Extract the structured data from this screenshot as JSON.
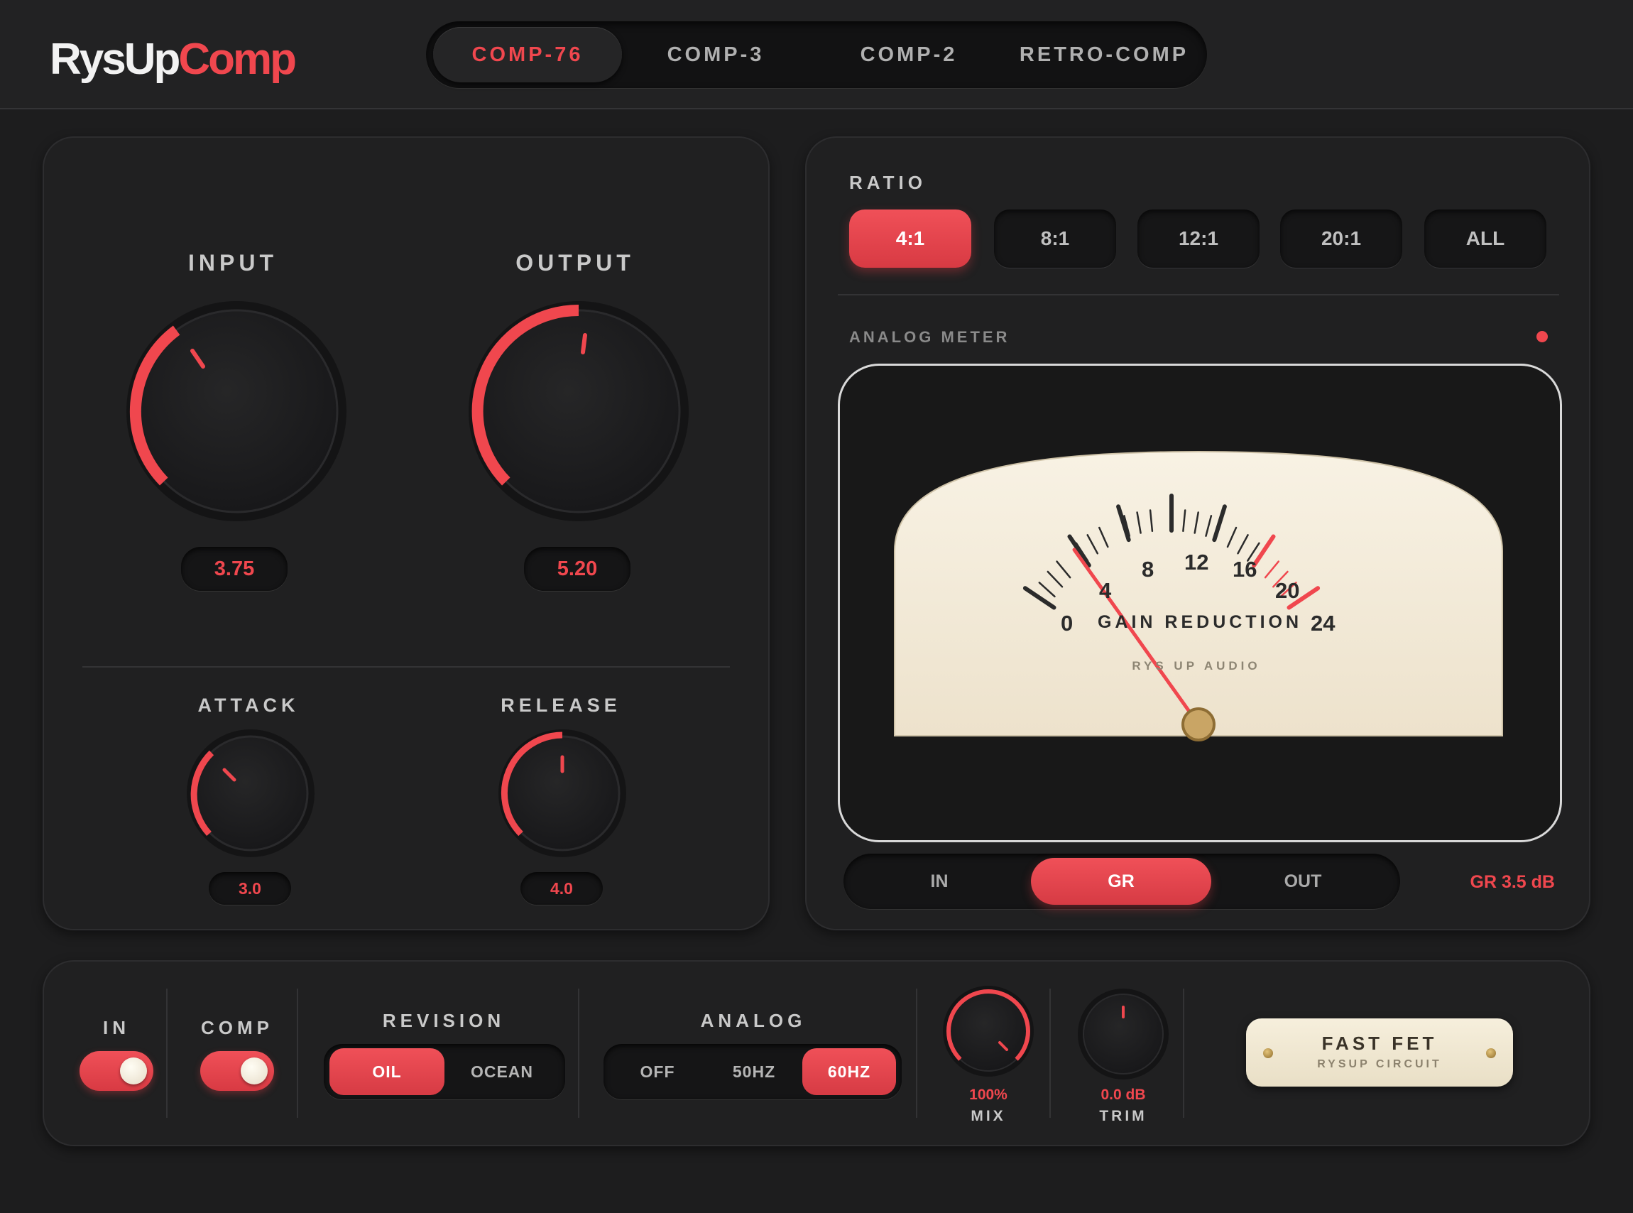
{
  "app": {
    "logo_part1": "RysUp",
    "logo_part2": "Comp",
    "accent_color": "#f0474e"
  },
  "tabs": [
    {
      "label": "COMP-76",
      "active": true
    },
    {
      "label": "COMP-3",
      "active": false
    },
    {
      "label": "COMP-2",
      "active": false
    },
    {
      "label": "RETRO-COMP",
      "active": false
    }
  ],
  "knobs": {
    "input": {
      "label": "INPUT",
      "value": "3.75"
    },
    "output": {
      "label": "OUTPUT",
      "value": "5.20"
    },
    "attack": {
      "label": "ATTACK",
      "value": "3.0"
    },
    "release": {
      "label": "RELEASE",
      "value": "4.0"
    }
  },
  "ratio": {
    "label": "RATIO",
    "options": [
      "4:1",
      "8:1",
      "12:1",
      "20:1",
      "ALL"
    ],
    "selected": "4:1"
  },
  "meter": {
    "label": "ANALOG METER",
    "scale": [
      "0",
      "4",
      "8",
      "12",
      "16",
      "20",
      "24"
    ],
    "caption": "GAIN REDUCTION",
    "brand": "RYS UP AUDIO",
    "modes": [
      "IN",
      "GR",
      "OUT"
    ],
    "selected_mode": "GR",
    "readout": "GR 3.5 dB"
  },
  "bottom": {
    "in_label": "IN",
    "comp_label": "COMP",
    "revision": {
      "label": "REVISION",
      "options": [
        "OIL",
        "OCEAN"
      ],
      "selected": "OIL"
    },
    "analog": {
      "label": "ANALOG",
      "options": [
        "OFF",
        "50HZ",
        "60HZ"
      ],
      "selected": "60HZ"
    },
    "mix": {
      "label": "MIX",
      "value": "100%"
    },
    "trim": {
      "label": "TRIM",
      "value": "0.0 dB"
    },
    "plate": {
      "title": "FAST FET",
      "subtitle": "RYSUP CIRCUIT"
    }
  }
}
